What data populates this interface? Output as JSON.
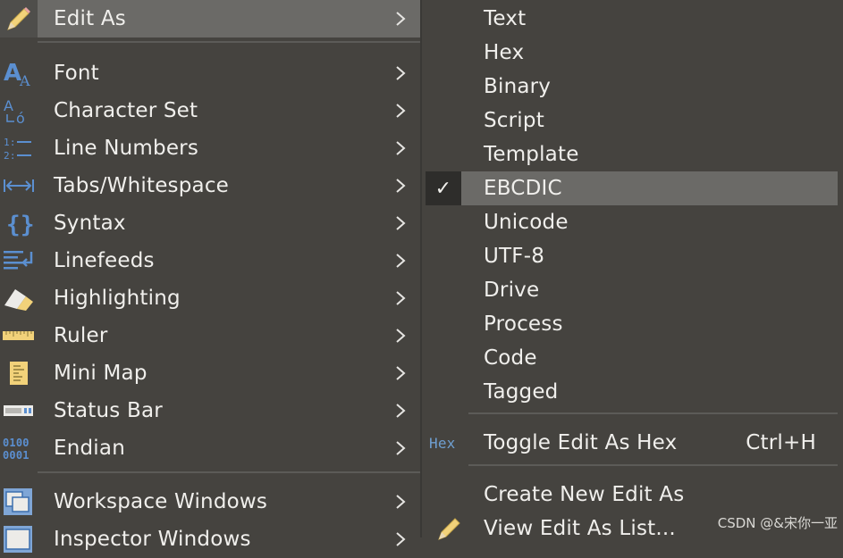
{
  "left_menu": {
    "items": [
      {
        "label": "Edit As",
        "icon": "pencil-icon"
      },
      {
        "label": "Font",
        "icon": "font-icon"
      },
      {
        "label": "Character Set",
        "icon": "character-set-icon"
      },
      {
        "label": "Line Numbers",
        "icon": "line-numbers-icon"
      },
      {
        "label": "Tabs/Whitespace",
        "icon": "tabs-whitespace-icon"
      },
      {
        "label": "Syntax",
        "icon": "braces-icon"
      },
      {
        "label": "Linefeeds",
        "icon": "linefeeds-icon"
      },
      {
        "label": "Highlighting",
        "icon": "highlighter-icon"
      },
      {
        "label": "Ruler",
        "icon": "ruler-icon"
      },
      {
        "label": "Mini Map",
        "icon": "mini-map-icon"
      },
      {
        "label": "Status Bar",
        "icon": "status-bar-icon"
      },
      {
        "label": "Endian",
        "icon": "endian-icon"
      },
      {
        "label": "Workspace Windows",
        "icon": "workspace-windows-icon"
      },
      {
        "label": "Inspector Windows",
        "icon": "inspector-windows-icon"
      }
    ],
    "submenu_arrow": "›"
  },
  "right_menu": {
    "items": [
      {
        "label": "Text"
      },
      {
        "label": "Hex"
      },
      {
        "label": "Binary"
      },
      {
        "label": "Script"
      },
      {
        "label": "Template"
      },
      {
        "label": "EBCDIC",
        "checked": true
      },
      {
        "label": "Unicode"
      },
      {
        "label": "UTF-8"
      },
      {
        "label": "Drive"
      },
      {
        "label": "Process"
      },
      {
        "label": "Code"
      },
      {
        "label": "Tagged"
      }
    ],
    "toggle": {
      "label": "Toggle Edit As Hex",
      "shortcut": "Ctrl+H",
      "icon_text": "Hex"
    },
    "create": {
      "label": "Create New Edit As"
    },
    "view": {
      "label": "View Edit As List..."
    },
    "check_mark": "✓"
  },
  "watermark": "CSDN @&宋你一亚",
  "colors": {
    "background": "#45433f",
    "highlight": "#6b6a67",
    "icon_blue": "#5b8fd0"
  }
}
